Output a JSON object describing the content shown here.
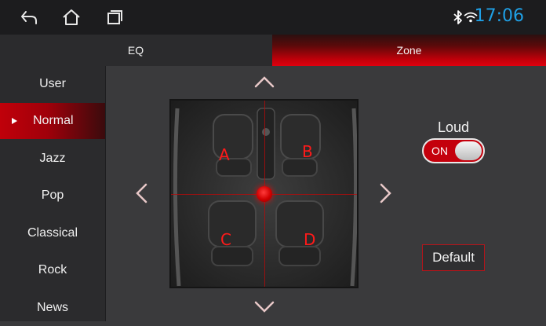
{
  "status_bar": {
    "time": "17:06",
    "icons": [
      "back-icon",
      "home-icon",
      "recent-apps-icon",
      "bluetooth-icon",
      "wifi-icon"
    ]
  },
  "tabs": [
    {
      "label": "EQ",
      "active": false
    },
    {
      "label": "Zone",
      "active": true
    }
  ],
  "sidebar": {
    "items": [
      {
        "label": "User",
        "active": false
      },
      {
        "label": "Normal",
        "active": true
      },
      {
        "label": "Jazz",
        "active": false
      },
      {
        "label": "Pop",
        "active": false
      },
      {
        "label": "Classical",
        "active": false
      },
      {
        "label": "Rock",
        "active": false
      },
      {
        "label": "News",
        "active": false
      }
    ]
  },
  "zone": {
    "labels": {
      "a": "A",
      "b": "B",
      "c": "C",
      "d": "D"
    },
    "arrows": [
      "chevron-up-icon",
      "chevron-down-icon",
      "chevron-left-icon",
      "chevron-right-icon"
    ]
  },
  "loud": {
    "label": "Loud",
    "state": "ON"
  },
  "default_button": "Default",
  "colors": {
    "accent": "#d0000c",
    "time": "#1fa0e6",
    "zone_label": "#ff1a1a"
  }
}
